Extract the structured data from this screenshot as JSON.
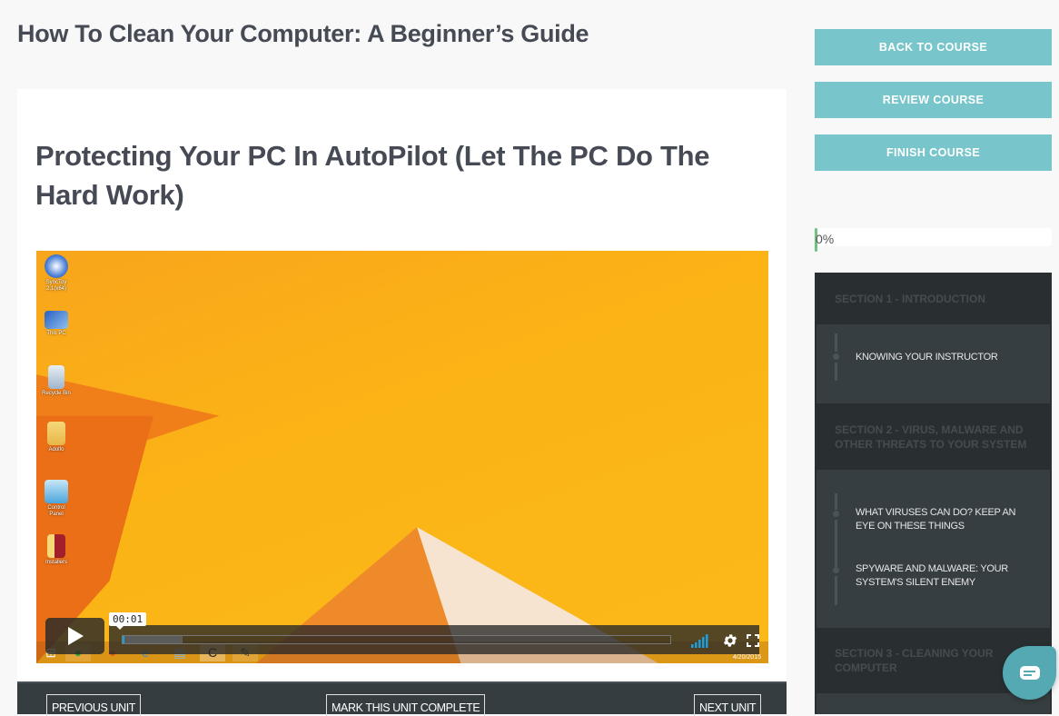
{
  "course": {
    "title": "How To Clean Your Computer: A Beginner’s Guide"
  },
  "unit": {
    "title": "Protecting Your PC In AutoPilot (Let The PC Do The Hard Work)"
  },
  "video": {
    "current_time": "00:01",
    "played_fraction": 0.003,
    "buffered_fraction": 0.11,
    "desktop_icons": [
      {
        "label": "SyncToy 2.1(x64)",
        "icon": "synctoy-icon"
      },
      {
        "label": "This PC",
        "icon": "computer-icon"
      },
      {
        "label": "Recycle Bin",
        "icon": "recycle-bin-icon"
      },
      {
        "label": "Adolfo",
        "icon": "user-folder-icon"
      },
      {
        "label": "Control Panel",
        "icon": "control-panel-icon"
      },
      {
        "label": "Installers",
        "icon": "folder-icon"
      }
    ],
    "taskbar_date": "4/20/2015",
    "controls": {
      "play": "play-icon",
      "quality": "signal-bars-icon",
      "settings": "gear-icon",
      "fullscreen": "fullscreen-icon"
    }
  },
  "footer": {
    "previous_label": "PREVIOUS UNIT",
    "complete_label": "MARK THIS UNIT COMPLETE",
    "next_label": "NEXT UNIT"
  },
  "sidebar": {
    "buttons": [
      {
        "label": "BACK TO COURSE"
      },
      {
        "label": "REVIEW COURSE"
      },
      {
        "label": "FINISH COURSE"
      }
    ],
    "progress": {
      "value": 0,
      "label": "0%"
    },
    "sections": [
      {
        "title": "SECTION 1 - INTRODUCTION",
        "units": [
          {
            "title": "KNOWING YOUR INSTRUCTOR"
          }
        ]
      },
      {
        "title": "SECTION 2 - VIRUS, MALWARE AND OTHER THREATS TO YOUR SYSTEM",
        "units": [
          {
            "title": "WHAT VIRUSES CAN DO? KEEP AN EYE ON THESE THINGS"
          },
          {
            "title": "SPYWARE AND MALWARE: YOUR SYSTEM'S SILENT ENEMY"
          }
        ]
      },
      {
        "title": "SECTION 3 - CLEANING YOUR COMPUTER",
        "units": []
      }
    ]
  },
  "colors": {
    "accent": "#78c6cb",
    "progress_fill": "#6fc37e",
    "sidebar_bg": "#363e41",
    "section_header_bg": "#292f31",
    "chat_bubble": "#55a9b2"
  }
}
